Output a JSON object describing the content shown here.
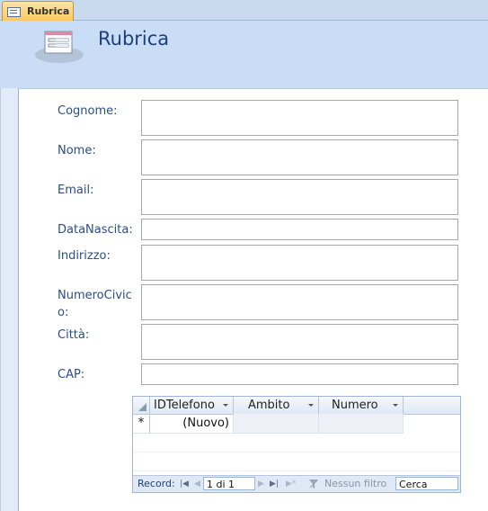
{
  "tab": {
    "label": "Rubrica"
  },
  "form": {
    "title": "Rubrica"
  },
  "fields": [
    {
      "label": "Cognome:",
      "value": ""
    },
    {
      "label": "Nome:",
      "value": ""
    },
    {
      "label": "Email:",
      "value": ""
    },
    {
      "label": "DataNascita:",
      "value": ""
    },
    {
      "label": "Indirizzo:",
      "value": ""
    },
    {
      "label": "NumeroCivico:",
      "value": ""
    },
    {
      "label": "Città:",
      "value": ""
    },
    {
      "label": "CAP:",
      "value": ""
    }
  ],
  "subform": {
    "columns": [
      "IDTelefono",
      "Ambito",
      "Numero"
    ],
    "new_row_marker": "*",
    "new_row_value": "(Nuovo)",
    "nav": {
      "record_label": "Record:",
      "position": "1 di 1",
      "filter_label": "Nessun filtro",
      "search_placeholder": "Cerca"
    }
  },
  "colors": {
    "header_bg": "#c9ddf6",
    "label_text": "#2a4e8a",
    "tab_bg": "#fbc865"
  }
}
